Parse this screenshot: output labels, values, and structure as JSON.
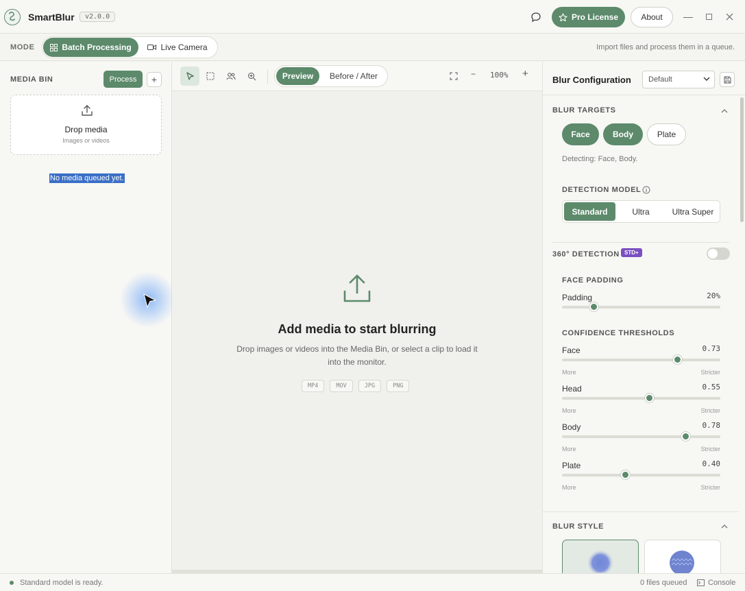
{
  "app": {
    "name": "SmartBlur",
    "version": "v2.0.0",
    "pro_label": "Pro License",
    "about_label": "About"
  },
  "modebar": {
    "label": "MODE",
    "batch_label": "Batch Processing",
    "live_label": "Live Camera",
    "hint": "Import files and process them in a queue."
  },
  "media_bin": {
    "title": "MEDIA BIN",
    "process_label": "Process",
    "add_label": "+",
    "drop_title": "Drop media",
    "drop_subtitle": "Images or videos",
    "empty_text": "No media queued yet."
  },
  "monitor": {
    "view_preview": "Preview",
    "view_before_after": "Before / After",
    "zoom_minus": "−",
    "zoom_level": "100%",
    "zoom_plus": "+",
    "empty_title": "Add media to start blurring",
    "empty_desc": "Drop images or videos into the Media Bin, or select a clip to load it into the monitor.",
    "formats": [
      "MP4",
      "MOV",
      "JPG",
      "PNG"
    ]
  },
  "config": {
    "title": "Blur Configuration",
    "preset": "Default",
    "targets_title": "BLUR TARGETS",
    "targets": [
      {
        "label": "Face",
        "active": true
      },
      {
        "label": "Body",
        "active": true
      },
      {
        "label": "Plate",
        "active": false
      }
    ],
    "detecting_text": "Detecting: Face, Body.",
    "model_title": "DETECTION MODEL",
    "models": [
      {
        "label": "Standard",
        "active": true
      },
      {
        "label": "Ultra",
        "active": false
      },
      {
        "label": "Ultra Super",
        "active": false
      }
    ],
    "detection_360_title": "360° DETECTION",
    "detection_360_badge": "STD+",
    "detection_360_enabled": false,
    "face_padding_title": "FACE PADDING",
    "padding_label": "Padding",
    "padding_value": "20%",
    "padding_fraction": 0.2,
    "confidence_title": "CONFIDENCE THRESHOLDS",
    "thresholds": [
      {
        "label": "Face",
        "value": "0.73",
        "fraction": 0.73,
        "low": "More",
        "high": "Stricter"
      },
      {
        "label": "Head",
        "value": "0.55",
        "fraction": 0.55,
        "low": "More",
        "high": "Stricter"
      },
      {
        "label": "Body",
        "value": "0.78",
        "fraction": 0.78,
        "low": "More",
        "high": "Stricter"
      },
      {
        "label": "Plate",
        "value": "0.40",
        "fraction": 0.4,
        "low": "More",
        "high": "Stricter"
      }
    ],
    "blur_style_title": "BLUR STYLE"
  },
  "status": {
    "text": "Standard model is ready.",
    "queued": "0 files queued",
    "console_label": "Console"
  },
  "colors": {
    "accent": "#5c8a6b",
    "badge": "#7b4fc2",
    "selection": "#3a6fc6"
  }
}
